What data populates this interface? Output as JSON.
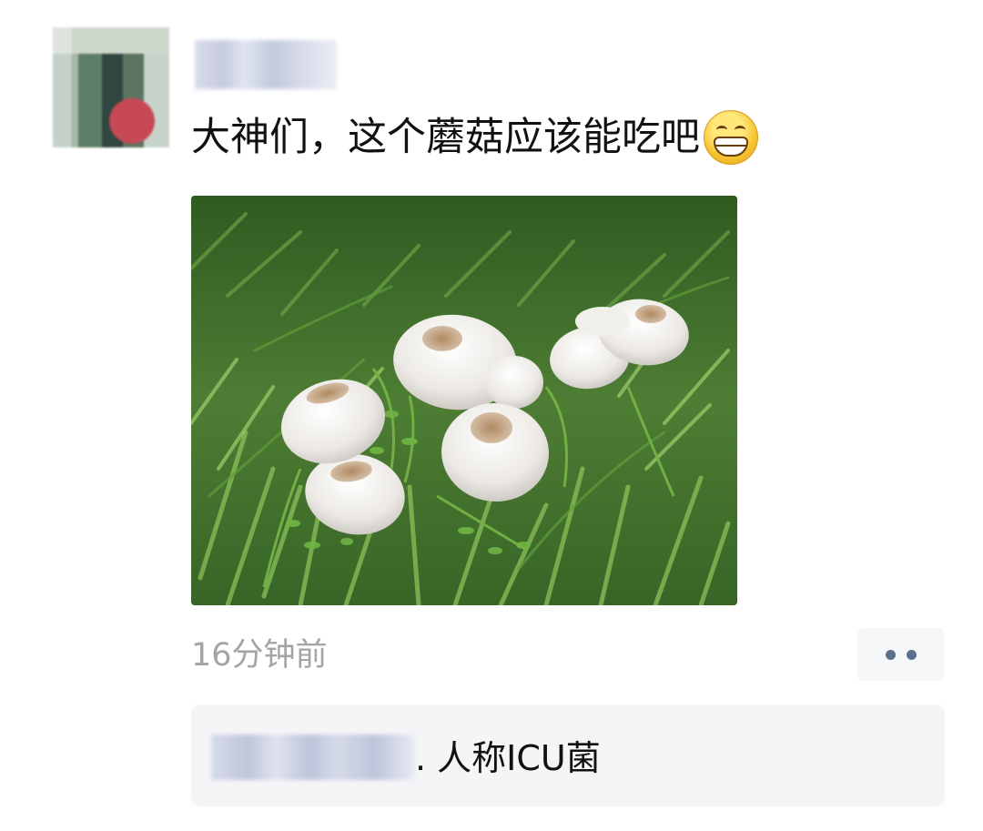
{
  "post": {
    "text": "大神们，这个蘑菇应该能吃吧",
    "emoji": "grinning-face-with-smiling-eyes",
    "image_subject": "mushrooms-in-grass"
  },
  "meta": {
    "timestamp": "16分钟前"
  },
  "actions": {
    "more_icon": "more-dots-icon"
  },
  "comment": {
    "text": ". 人称ICU菌"
  },
  "colors": {
    "timestamp": "#a4a4a4",
    "action_dots": "#5b6f8e",
    "comment_background": "#f5f5f7"
  }
}
